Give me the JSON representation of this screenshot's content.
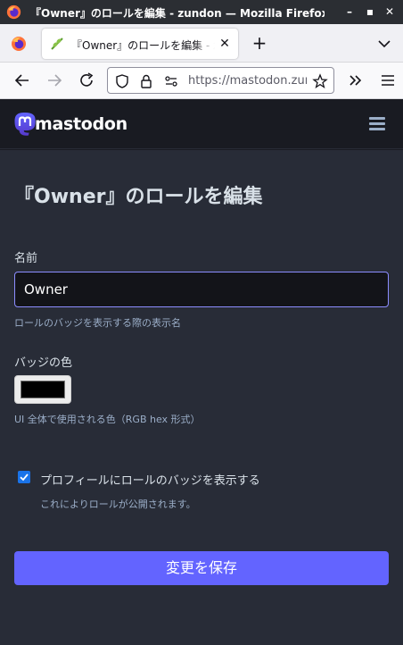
{
  "window": {
    "title": "『Owner』のロールを編集 - zundon — Mozilla Firefox",
    "minimize_glyph": "–",
    "maximize_glyph": "▪",
    "close_glyph": "✕"
  },
  "tab": {
    "title": "『Owner』のロールを編集 - zundon",
    "close_glyph": "✕",
    "favicon": "zunda-leaf-icon"
  },
  "tabbar": {
    "new_tab_glyph": "+"
  },
  "urlbar": {
    "url": "https://mastodon.zundon.jp"
  },
  "mastodon": {
    "wordmark": "mastodon"
  },
  "page": {
    "title": "『Owner』のロールを編集",
    "name_label": "名前",
    "name_value": "Owner",
    "name_hint": "ロールのバッジを表示する際の表示名",
    "color_label": "バッジの色",
    "color_value": "#000000",
    "color_hint": "UI 全体で使用される色（RGB hex 形式）",
    "highlight_label": "プロフィールにロールのバッジを表示する",
    "highlight_checked": true,
    "highlight_hint": "これによりロールが公開されます。",
    "save_label": "変更を保存"
  },
  "colors": {
    "accent": "#6364ff",
    "background": "#282c37",
    "header": "#191b22"
  }
}
